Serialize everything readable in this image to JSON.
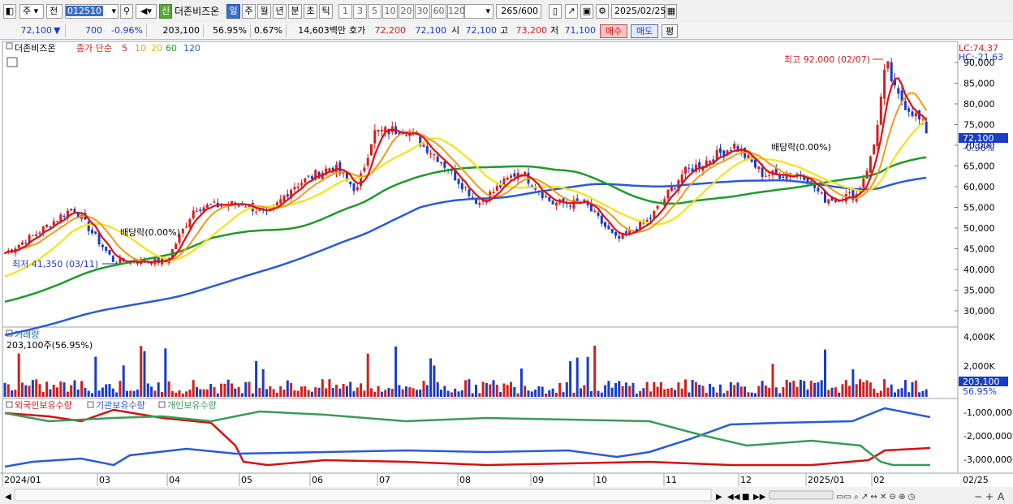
{
  "toolbar": {
    "mode1": "주",
    "mode2": "전",
    "code": "012510",
    "badge_new": "신",
    "stock_name": "더존비즈온",
    "periods": [
      "일",
      "주",
      "월",
      "년",
      "분",
      "초",
      "틱"
    ],
    "selected_period": "일",
    "intervals": [
      "1",
      "3",
      "5",
      "10",
      "20",
      "30",
      "60",
      "120"
    ],
    "count_value": "265",
    "count_total": "/600",
    "date": "2025/02/25"
  },
  "quote": {
    "price": "72,100",
    "arrow": "▼",
    "change": "700",
    "change_pct": "-0.96%",
    "volume": "203,100",
    "volume_ratio": "56.95%",
    "turnover_pct": "0.67%",
    "amount": "14,603백만",
    "ask_label": "호가",
    "ask1": "72,200",
    "ask2": "72,100",
    "open_label": "시",
    "open": "72,100",
    "high_label": "고",
    "high": "73,200",
    "low_label": "저",
    "low": "71,100",
    "buy_label": "매수",
    "sell_label": "매도",
    "even_label": "평"
  },
  "price_panel": {
    "legend_name": "더존비즈온",
    "legend_series": "종가 단순",
    "ma_periods": [
      "5",
      "10",
      "20",
      "60",
      "120"
    ],
    "lc": "LC:74.37",
    "hc": "HC:-21.63",
    "current_price": "72,100",
    "current_pct": "-0.96%",
    "annot_high": "최고 92,000 (02/07)",
    "annot_low": "최저 41,350 (03/11)",
    "annot_div1": "배당락(0.00%)",
    "annot_div2": "배당락(0.00%)",
    "y_ticks": [
      "90,000",
      "85,000",
      "80,000",
      "75,000",
      "70,000",
      "65,000",
      "60,000",
      "55,000",
      "50,000",
      "45,000",
      "40,000",
      "35,000",
      "30,000"
    ]
  },
  "volume_panel": {
    "title": "거래량",
    "info": "203,100주(56.95%)",
    "y_ticks": [
      "4,000K",
      "2,000K"
    ],
    "current": "203,100",
    "current_pct": "56.95%"
  },
  "holder_panel": {
    "legend": [
      "외국인보유수량",
      "기관보유수량",
      "개인보유수량"
    ],
    "y_ticks": [
      "-1,000,000",
      "-2,000,000",
      "-3,000,000"
    ]
  },
  "x_axis": {
    "labels": [
      "2024/01",
      "03",
      "04",
      "05",
      "06",
      "07",
      "08",
      "09",
      "10",
      "11",
      "12",
      "2025/01",
      "02"
    ],
    "right_label": "02/25"
  },
  "colors": {
    "up": "#d41e1e",
    "down": "#1a3cc8",
    "ma5": "#e01010",
    "ma10": "#f09a1a",
    "ma20": "#f4e21a",
    "ma60": "#1e9a2a",
    "ma120": "#2a5ad8",
    "foreign": "#2a5ad8",
    "institution": "#d41010",
    "individual": "#3a9a5a"
  }
}
